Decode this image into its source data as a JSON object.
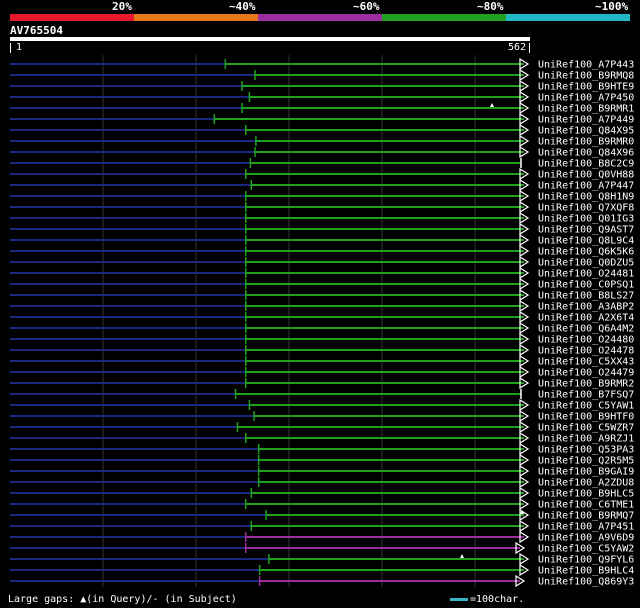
{
  "legend": {
    "segments": [
      {
        "label": "20%",
        "color": "#e8192c"
      },
      {
        "label": "~40%",
        "color": "#e6781a"
      },
      {
        "label": "~60%",
        "color": "#9b2fa0"
      },
      {
        "label": "~80%",
        "color": "#1fa31f"
      },
      {
        "label": "~100%",
        "color": "#20b8c4"
      }
    ]
  },
  "query": {
    "name": "AV765504",
    "start": "1",
    "end": "562"
  },
  "hits": [
    {
      "label": "UniRef100_A7P443",
      "start": 557,
      "color": "#1fa31f",
      "head": "tri"
    },
    {
      "label": "UniRef100_B9RMQ8",
      "start": 589,
      "color": "#1fa31f",
      "head": "tri"
    },
    {
      "label": "UniRef100_B9HTE9",
      "start": 575,
      "color": "#1fa31f",
      "head": "tri"
    },
    {
      "label": "UniRef100_A7P450",
      "start": 583,
      "color": "#1fa31f",
      "head": "tri"
    },
    {
      "label": "UniRef100_B9RMR1",
      "start": 575,
      "color": "#1fa31f",
      "head": "tri",
      "gap": true
    },
    {
      "label": "UniRef100_A7P449",
      "start": 545,
      "color": "#1fa31f",
      "head": "tri"
    },
    {
      "label": "UniRef100_Q84X95",
      "start": 579,
      "color": "#1fa31f",
      "head": "tri"
    },
    {
      "label": "UniRef100_B9RMR0",
      "start": 590,
      "color": "#1fa31f",
      "head": "tri"
    },
    {
      "label": "UniRef100_Q84X96",
      "start": 589,
      "color": "#1fa31f",
      "head": "tri"
    },
    {
      "label": "UniRef100_B8C2C9",
      "start": 584,
      "color": "#1fa31f",
      "head": "bar"
    },
    {
      "label": "UniRef100_Q0VH88",
      "start": 579,
      "color": "#1fa31f",
      "head": "tri"
    },
    {
      "label": "UniRef100_A7P447",
      "start": 585,
      "color": "#1fa31f",
      "head": "tri"
    },
    {
      "label": "UniRef100_Q8H1N9",
      "start": 579,
      "color": "#1fa31f",
      "head": "tri"
    },
    {
      "label": "UniRef100_Q7XQF8",
      "start": 579,
      "color": "#1fa31f",
      "head": "tri"
    },
    {
      "label": "UniRef100_Q01IG3",
      "start": 579,
      "color": "#1fa31f",
      "head": "tri"
    },
    {
      "label": "UniRef100_Q9AST7",
      "start": 579,
      "color": "#1fa31f",
      "head": "tri"
    },
    {
      "label": "UniRef100_Q8L9C4",
      "start": 579,
      "color": "#1fa31f",
      "head": "tri"
    },
    {
      "label": "UniRef100_Q6K5K6",
      "start": 579,
      "color": "#1fa31f",
      "head": "tri"
    },
    {
      "label": "UniRef100_Q0DZU5",
      "start": 579,
      "color": "#1fa31f",
      "head": "tri"
    },
    {
      "label": "UniRef100_O24481",
      "start": 579,
      "color": "#1fa31f",
      "head": "tri"
    },
    {
      "label": "UniRef100_C0PSQ1",
      "start": 579,
      "color": "#1fa31f",
      "head": "tri"
    },
    {
      "label": "UniRef100_B8LS27",
      "start": 579,
      "color": "#1fa31f",
      "head": "tri"
    },
    {
      "label": "UniRef100_A3ABP2",
      "start": 579,
      "color": "#1fa31f",
      "head": "tri"
    },
    {
      "label": "UniRef100_A2X6T4",
      "start": 579,
      "color": "#1fa31f",
      "head": "tri"
    },
    {
      "label": "UniRef100_Q6A4M2",
      "start": 579,
      "color": "#1fa31f",
      "head": "tri"
    },
    {
      "label": "UniRef100_O24480",
      "start": 579,
      "color": "#1fa31f",
      "head": "tri"
    },
    {
      "label": "UniRef100_O24478",
      "start": 579,
      "color": "#1fa31f",
      "head": "tri"
    },
    {
      "label": "UniRef100_C5XX43",
      "start": 579,
      "color": "#1fa31f",
      "head": "tri"
    },
    {
      "label": "UniRef100_O24479",
      "start": 579,
      "color": "#1fa31f",
      "head": "tri"
    },
    {
      "label": "UniRef100_B9RMR2",
      "start": 579,
      "color": "#1fa31f",
      "head": "tri"
    },
    {
      "label": "UniRef100_B7FSQ7",
      "start": 568,
      "color": "#1fa31f",
      "head": "bar"
    },
    {
      "label": "UniRef100_C5YAW1",
      "start": 583,
      "color": "#1fa31f",
      "head": "tri"
    },
    {
      "label": "UniRef100_B9HTF0",
      "start": 588,
      "color": "#1fa31f",
      "head": "tri"
    },
    {
      "label": "UniRef100_C5WZR7",
      "start": 570,
      "color": "#1fa31f",
      "head": "tri"
    },
    {
      "label": "UniRef100_A9RZJ1",
      "start": 579,
      "color": "#1fa31f",
      "head": "tri"
    },
    {
      "label": "UniRef100_Q53PA3",
      "start": 593,
      "color": "#1fa31f",
      "head": "tri"
    },
    {
      "label": "UniRef100_Q2R5M5",
      "start": 593,
      "color": "#1fa31f",
      "head": "tri"
    },
    {
      "label": "UniRef100_B9GAI9",
      "start": 593,
      "color": "#1fa31f",
      "head": "tri"
    },
    {
      "label": "UniRef100_A2ZDU8",
      "start": 593,
      "color": "#1fa31f",
      "head": "tri"
    },
    {
      "label": "UniRef100_B9HLC5",
      "start": 585,
      "color": "#1fa31f",
      "head": "tri"
    },
    {
      "label": "UniRef100_C6TME1",
      "start": 579,
      "color": "#1fa31f",
      "head": "tri"
    },
    {
      "label": "UniRef100_B9RMQ7",
      "start": 601,
      "color": "#1fa31f",
      "head": "tri",
      "gap": true
    },
    {
      "label": "UniRef100_A7P451",
      "start": 585,
      "color": "#1fa31f",
      "head": "tri"
    },
    {
      "label": "UniRef100_A9V6D9",
      "start": 579,
      "color": "#9b2fa0",
      "head": "tri"
    },
    {
      "label": "UniRef100_C5YAW2",
      "start": 579,
      "color": "#9b2fa0",
      "head": "tri-short"
    },
    {
      "label": "UniRef100_Q9FYL6",
      "start": 604,
      "color": "#1fa31f",
      "head": "tri",
      "gap": true
    },
    {
      "label": "UniRef100_B9HLC4",
      "start": 594,
      "color": "#1fa31f",
      "head": "tri"
    },
    {
      "label": "UniRef100_Q869Y3",
      "start": 594,
      "color": "#9b2fa0",
      "head": "tri-short"
    }
  ],
  "footer": {
    "gaps_text": "Large gaps: ▲(in Query)/- (in Subject)",
    "scale_text": "=100char."
  }
}
